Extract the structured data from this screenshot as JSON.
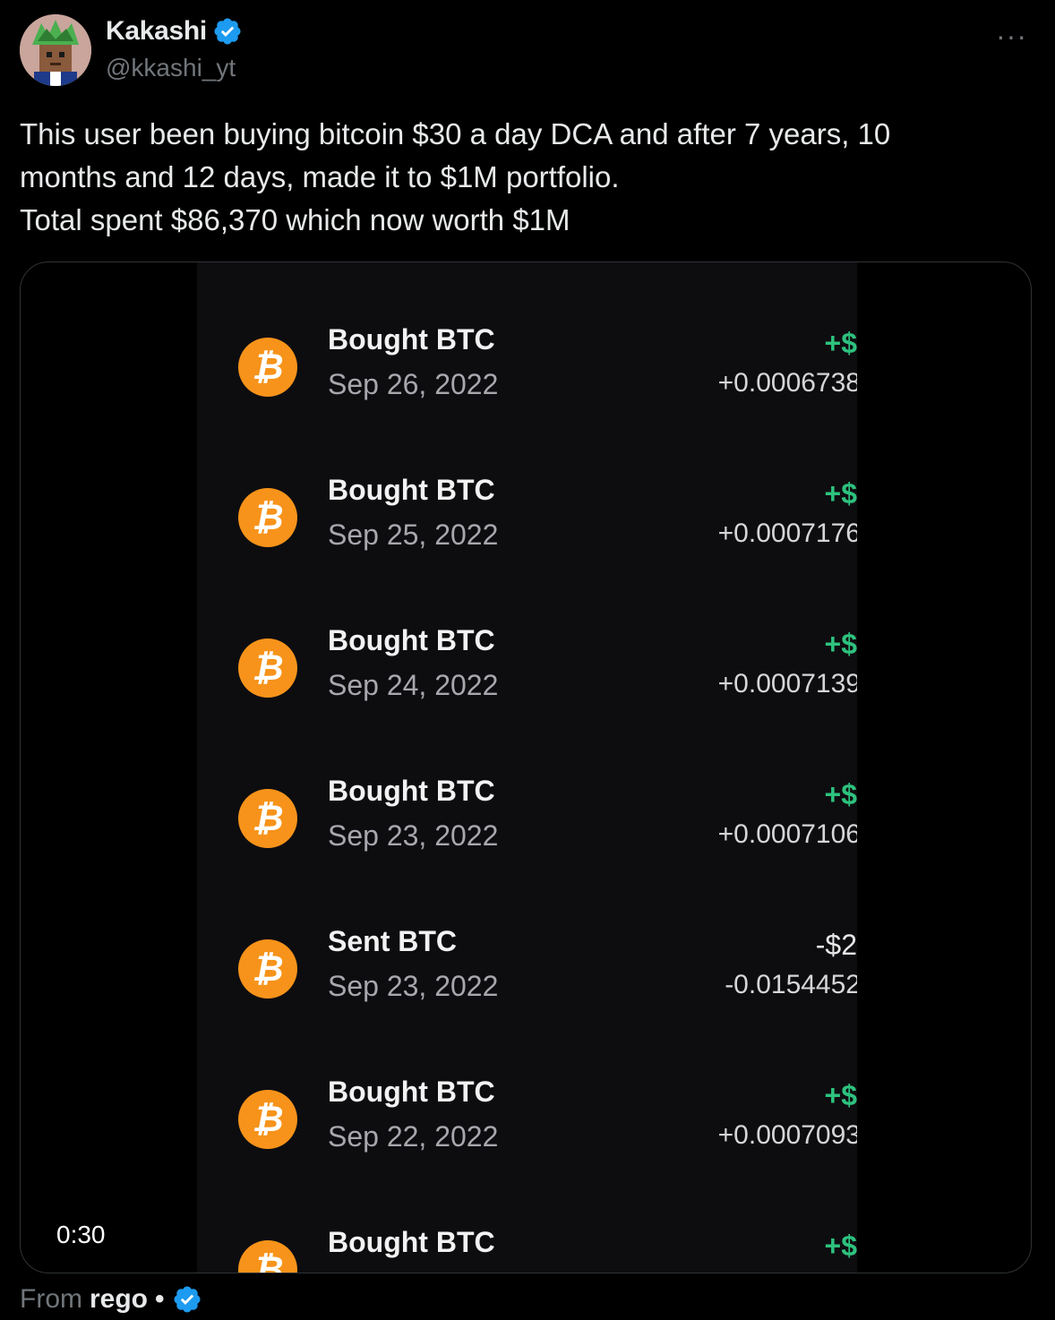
{
  "author": {
    "display_name": "Kakashi",
    "handle": "@kkashi_yt",
    "verified": true
  },
  "menu_icon": "more-horizontal-icon",
  "tweet": {
    "lines": [
      "This user been buying bitcoin $30 a day DCA and after 7 years, 10",
      "months and 12 days, made it to $1M portfolio.",
      "Total spent $86,370 which now worth $1M"
    ]
  },
  "video": {
    "timestamp": "0:30",
    "transactions": [
      {
        "title": "Bought BTC",
        "date": "Sep 26, 2022",
        "usd": "+$",
        "btc": "+0.0006738",
        "type": "buy"
      },
      {
        "title": "Bought BTC",
        "date": "Sep 25, 2022",
        "usd": "+$",
        "btc": "+0.0007176",
        "type": "buy"
      },
      {
        "title": "Bought BTC",
        "date": "Sep 24, 2022",
        "usd": "+$",
        "btc": "+0.0007139",
        "type": "buy"
      },
      {
        "title": "Bought BTC",
        "date": "Sep 23, 2022",
        "usd": "+$",
        "btc": "+0.0007106",
        "type": "buy"
      },
      {
        "title": "Sent BTC",
        "date": "Sep 23, 2022",
        "usd": "-$2",
        "btc": "-0.0154452",
        "type": "sent"
      },
      {
        "title": "Bought BTC",
        "date": "Sep 22, 2022",
        "usd": "+$",
        "btc": "+0.0007093",
        "type": "buy"
      },
      {
        "title": "Bought BTC",
        "date": "",
        "usd": "+$",
        "btc": "",
        "type": "buy"
      }
    ]
  },
  "source": {
    "from_label": "From",
    "user": "rego",
    "separator": "•",
    "verified": true
  },
  "colors": {
    "verified_blue": "#1d9bf0",
    "btc_orange": "#f7931a",
    "gain_green": "#2ec27e"
  }
}
